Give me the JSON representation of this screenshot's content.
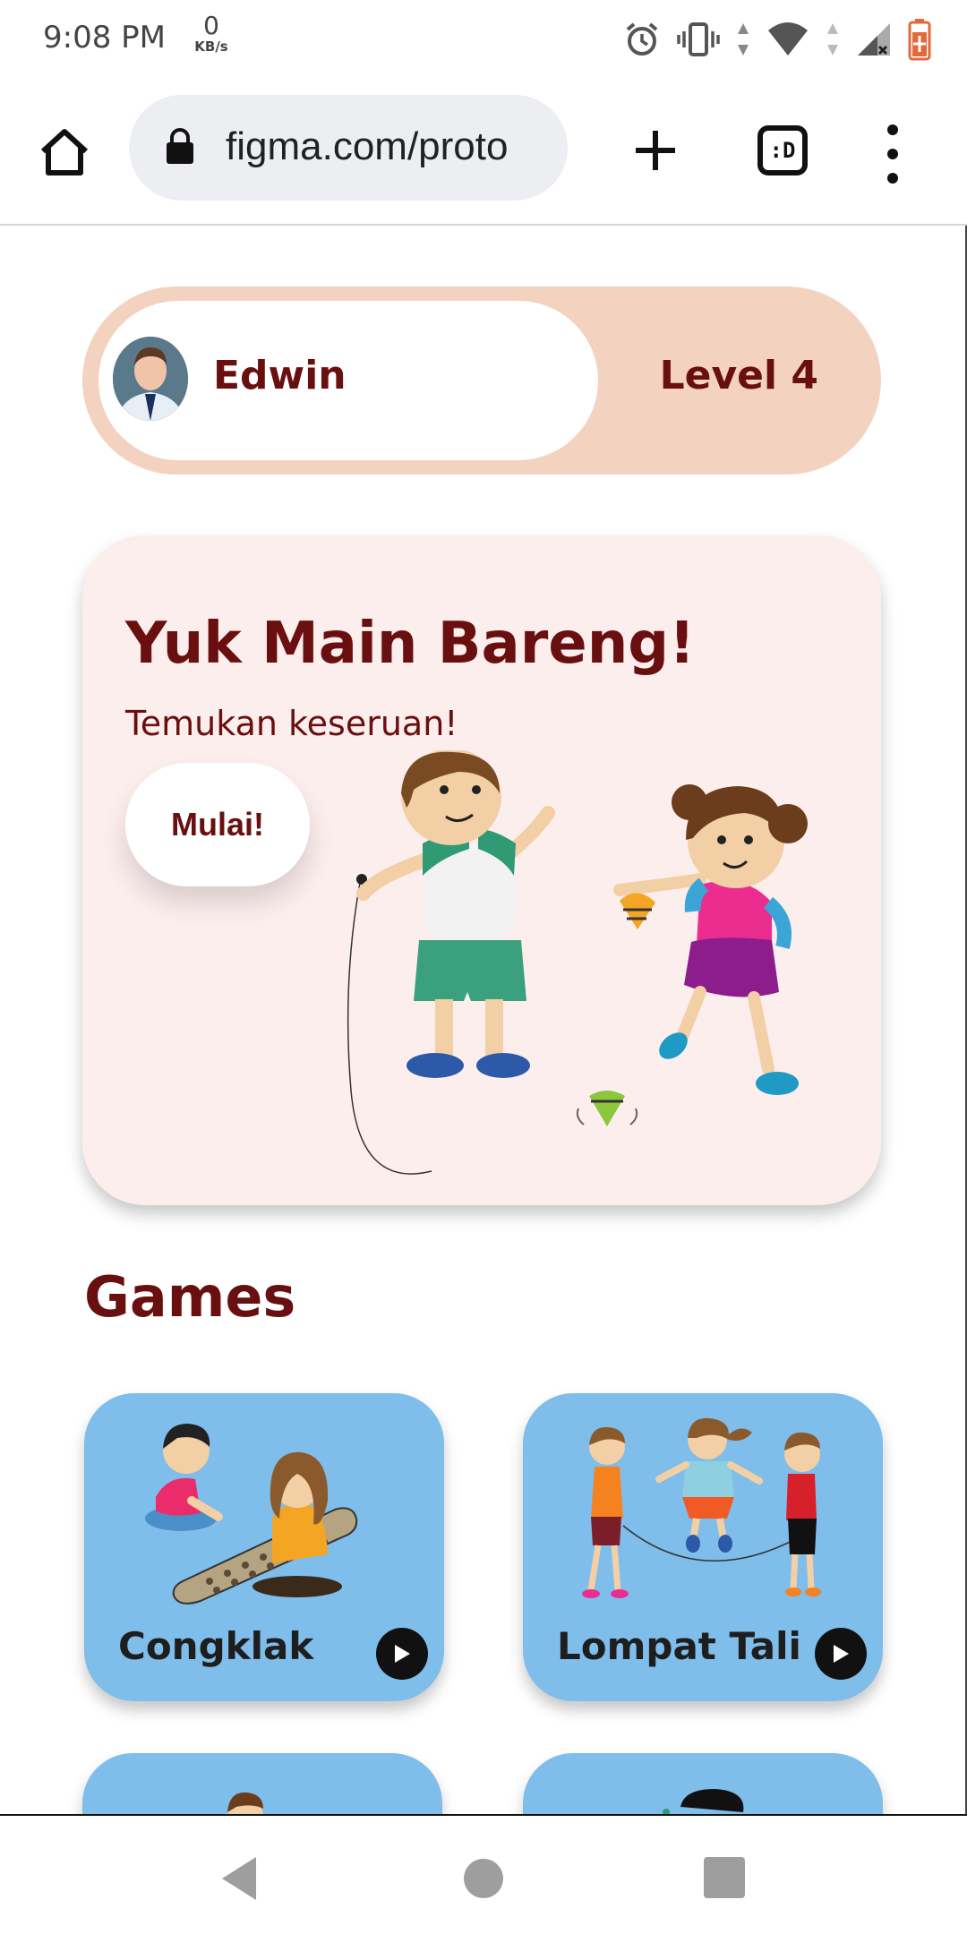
{
  "status_bar": {
    "time": "9:08 PM",
    "net_speed_value": "0",
    "net_speed_unit": "KB/s",
    "icons": [
      "alarm-icon",
      "vibrate-icon",
      "data-arrows-icon",
      "wifi-icon",
      "cellular-signal-icon",
      "battery-charging-icon"
    ]
  },
  "browser": {
    "url": "figma.com/proto",
    "tab_switcher_label": ":D",
    "icons": [
      "home-icon",
      "lock-icon",
      "new-tab-plus-icon",
      "tab-switcher-icon",
      "overflow-menu-icon"
    ]
  },
  "profile": {
    "name": "Edwin",
    "level": "Level 4"
  },
  "hero": {
    "title": "Yuk Main Bareng!",
    "subtitle": "Temukan keseruan!",
    "button_label": "Mulai!"
  },
  "games": {
    "title": "Games",
    "items": [
      {
        "name": "Congklak"
      },
      {
        "name": "Lompat Tali"
      },
      {
        "name": ""
      },
      {
        "name": ""
      }
    ]
  },
  "colors": {
    "accent_text": "#6a0f10",
    "profile_pill": "#f3d3c0",
    "hero_bg": "#fdeeee",
    "card_bg": "#7fbdea"
  },
  "nav": {
    "icons": [
      "back-icon",
      "home-circle-icon",
      "recents-square-icon"
    ]
  }
}
